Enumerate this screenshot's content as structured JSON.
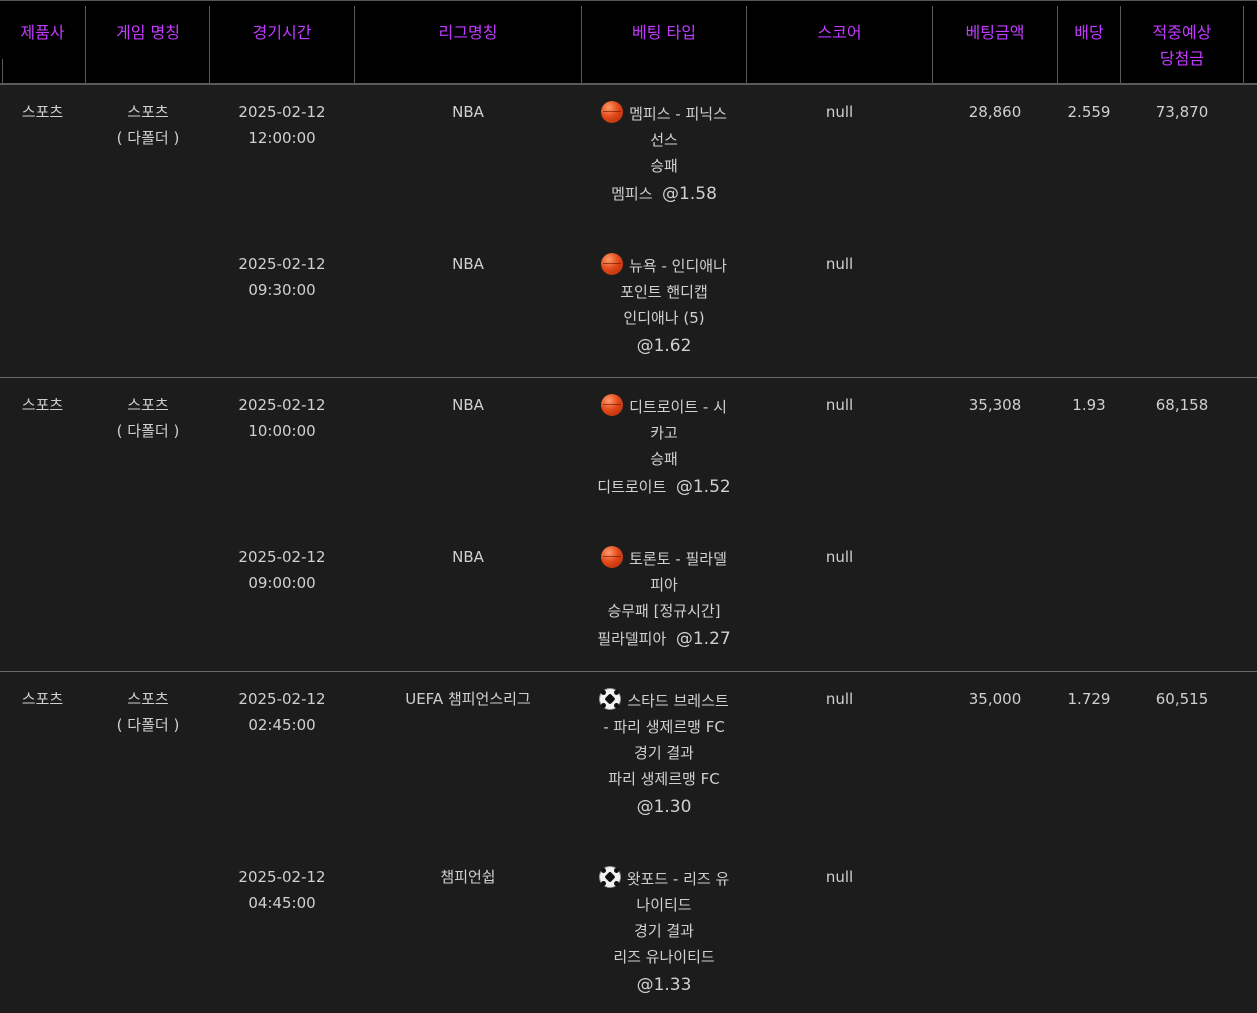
{
  "header": {
    "provider": "제품사",
    "game_name": "게임 명칭",
    "match_time": "경기시간",
    "league": "리그명칭",
    "bet_type": "베팅 타입",
    "score": "스코어",
    "bet_amount": "베팅금액",
    "odds": "배당",
    "expected_win_line1": "적중예상",
    "expected_win_line2": "당첨금"
  },
  "groups": [
    {
      "provider": "스포츠",
      "game_name": "스포츠",
      "game_type": "( 다폴더 )",
      "bet_amount": "28,860",
      "odds": "2.559",
      "expected_win": "73,870",
      "bets": [
        {
          "date": "2025-02-12",
          "time": "12:00:00",
          "league": "NBA",
          "icon": "basketball-icon",
          "match_line1": "멤피스 - 피닉스",
          "match_line2": "선스",
          "market": "승패",
          "pick": "멤피스",
          "odds": "@1.58",
          "score": "null"
        },
        {
          "date": "2025-02-12",
          "time": "09:30:00",
          "league": "NBA",
          "icon": "basketball-icon",
          "match_line1": "뉴욕 - 인디애나",
          "match_line2": "",
          "market": "포인트 핸디캡",
          "pick": "인디애나 (5)",
          "odds": "@1.62",
          "score": "null"
        }
      ]
    },
    {
      "provider": "스포츠",
      "game_name": "스포츠",
      "game_type": "( 다폴더 )",
      "bet_amount": "35,308",
      "odds": "1.93",
      "expected_win": "68,158",
      "bets": [
        {
          "date": "2025-02-12",
          "time": "10:00:00",
          "league": "NBA",
          "icon": "basketball-icon",
          "match_line1": "디트로이트 - 시",
          "match_line2": "카고",
          "market": "승패",
          "pick": "디트로이트",
          "odds": "@1.52",
          "score": "null"
        },
        {
          "date": "2025-02-12",
          "time": "09:00:00",
          "league": "NBA",
          "icon": "basketball-icon",
          "match_line1": "토론토 - 필라델",
          "match_line2": "피아",
          "market": "승무패 [정규시간]",
          "pick": "필라델피아",
          "odds": "@1.27",
          "score": "null"
        }
      ]
    },
    {
      "provider": "스포츠",
      "game_name": "스포츠",
      "game_type": "( 다폴더 )",
      "bet_amount": "35,000",
      "odds": "1.729",
      "expected_win": "60,515",
      "bets": [
        {
          "date": "2025-02-12",
          "time": "02:45:00",
          "league": "UEFA 챔피언스리그",
          "icon": "soccer-ball-icon",
          "match_line1": "스타드 브레스트",
          "match_line2": "- 파리 생제르맹 FC",
          "market": "경기 결과",
          "pick": "파리 생제르맹 FC",
          "odds": "@1.30",
          "score": "null"
        },
        {
          "date": "2025-02-12",
          "time": "04:45:00",
          "league": "챔피언쉽",
          "icon": "soccer-ball-icon",
          "match_line1": "왓포드 - 리즈 유",
          "match_line2": "나이티드",
          "market": "경기 결과",
          "pick": "리즈 유나이티드",
          "odds": "@1.33",
          "score": "null"
        }
      ]
    }
  ]
}
